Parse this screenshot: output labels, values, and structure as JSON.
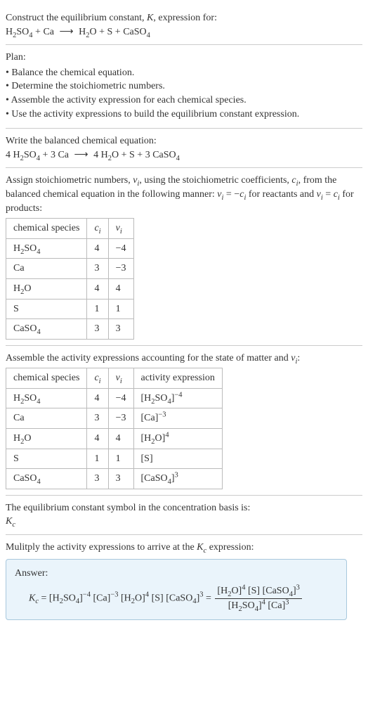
{
  "intro": {
    "line1_a": "Construct the equilibrium constant, ",
    "line1_b": ", expression for:"
  },
  "eq1": {
    "r1": "H",
    "r1s": "2",
    "r1b": "SO",
    "r1bs": "4",
    "plus1": " + ",
    "r2": "Ca",
    "arrow": "⟶",
    "p1": "H",
    "p1s": "2",
    "p1b": "O",
    "plus2": " + ",
    "p2": "S",
    "plus3": " + ",
    "p3": "CaSO",
    "p3s": "4"
  },
  "plan": {
    "title": "Plan:",
    "items": [
      "Balance the chemical equation.",
      "Determine the stoichiometric numbers.",
      "Assemble the activity expression for each chemical species.",
      "Use the activity expressions to build the equilibrium constant expression."
    ]
  },
  "balanced": {
    "title": "Write the balanced chemical equation:",
    "c1": "4 ",
    "r1": "H",
    "r1s": "2",
    "r1b": "SO",
    "r1bs": "4",
    "plus1": " + ",
    "c2": "3 ",
    "r2": "Ca",
    "arrow": "⟶",
    "c3": "4 ",
    "p1": "H",
    "p1s": "2",
    "p1b": "O",
    "plus2": " + ",
    "p2": "S",
    "plus3": " + ",
    "c4": "3 ",
    "p3": "CaSO",
    "p3s": "4"
  },
  "stoich": {
    "text1": "Assign stoichiometric numbers, ",
    "text2": ", using the stoichiometric coefficients, ",
    "text3": ", from the balanced chemical equation in the following manner: ",
    "text4": " for reactants and ",
    "text5": " for products:",
    "vi": "ν",
    "vis": "i",
    "ci": "c",
    "cis": "i",
    "eqr": " = −",
    "eqp": " = "
  },
  "table1": {
    "h1": "chemical species",
    "h2": "c",
    "h2s": "i",
    "h3": "ν",
    "h3s": "i",
    "rows": [
      {
        "s1": "H",
        "s1s": "2",
        "s1b": "SO",
        "s1bs": "4",
        "c": "4",
        "v": "−4"
      },
      {
        "s1": "Ca",
        "s1s": "",
        "s1b": "",
        "s1bs": "",
        "c": "3",
        "v": "−3"
      },
      {
        "s1": "H",
        "s1s": "2",
        "s1b": "O",
        "s1bs": "",
        "c": "4",
        "v": "4"
      },
      {
        "s1": "S",
        "s1s": "",
        "s1b": "",
        "s1bs": "",
        "c": "1",
        "v": "1"
      },
      {
        "s1": "CaSO",
        "s1s": "4",
        "s1b": "",
        "s1bs": "",
        "c": "3",
        "v": "3"
      }
    ]
  },
  "activity": {
    "text1": "Assemble the activity expressions accounting for the state of matter and ",
    "text2": ":"
  },
  "table2": {
    "h1": "chemical species",
    "h2": "c",
    "h2s": "i",
    "h3": "ν",
    "h3s": "i",
    "h4": "activity expression",
    "rows": [
      {
        "s1": "H",
        "s1s": "2",
        "s1b": "SO",
        "s1bs": "4",
        "c": "4",
        "v": "−4",
        "ae": "[H",
        "aes": "2",
        "aeb": "SO",
        "aebs": "4",
        "aec": "]",
        "aep": "−4"
      },
      {
        "s1": "Ca",
        "s1s": "",
        "s1b": "",
        "s1bs": "",
        "c": "3",
        "v": "−3",
        "ae": "[Ca]",
        "aes": "",
        "aeb": "",
        "aebs": "",
        "aec": "",
        "aep": "−3"
      },
      {
        "s1": "H",
        "s1s": "2",
        "s1b": "O",
        "s1bs": "",
        "c": "4",
        "v": "4",
        "ae": "[H",
        "aes": "2",
        "aeb": "O]",
        "aebs": "",
        "aec": "",
        "aep": "4"
      },
      {
        "s1": "S",
        "s1s": "",
        "s1b": "",
        "s1bs": "",
        "c": "1",
        "v": "1",
        "ae": "[S]",
        "aes": "",
        "aeb": "",
        "aebs": "",
        "aec": "",
        "aep": ""
      },
      {
        "s1": "CaSO",
        "s1s": "4",
        "s1b": "",
        "s1bs": "",
        "c": "3",
        "v": "3",
        "ae": "[CaSO",
        "aes": "4",
        "aeb": "]",
        "aebs": "",
        "aec": "",
        "aep": "3"
      }
    ]
  },
  "symbol": {
    "text1": "The equilibrium constant symbol in the concentration basis is:",
    "kc_k": "K",
    "kc_c": "c"
  },
  "multiply": {
    "text1": "Mulitply the activity expressions to arrive at the ",
    "text2": " expression:"
  },
  "answer": {
    "label": "Answer:",
    "eq": " = ",
    "t1": "[H",
    "t1s": "2",
    "t1b": "SO",
    "t1bs": "4",
    "t1c": "]",
    "t1p": "−4",
    "sp": " ",
    "t2": "[Ca]",
    "t2p": "−3",
    "t3": "[H",
    "t3s": "2",
    "t3b": "O]",
    "t3p": "4",
    "t4": "[S]",
    "t5": "[CaSO",
    "t5s": "4",
    "t5c": "]",
    "t5p": "3",
    "eq2": " = ",
    "num1": "[H",
    "num1s": "2",
    "num1b": "O]",
    "num1p": "4",
    "num2": " [S] ",
    "num3": "[CaSO",
    "num3s": "4",
    "num3c": "]",
    "num3p": "3",
    "den1": "[H",
    "den1s": "2",
    "den1b": "SO",
    "den1bs": "4",
    "den1c": "]",
    "den1p": "4",
    "den2": " [Ca]",
    "den2p": "3"
  }
}
